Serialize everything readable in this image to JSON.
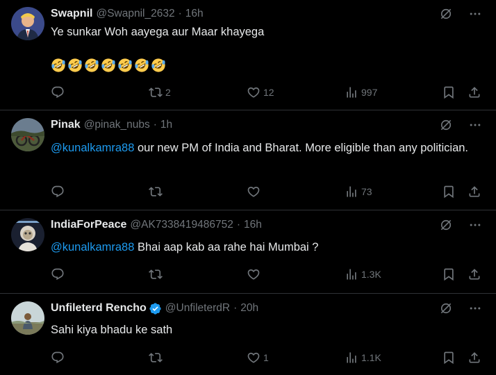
{
  "tweets": [
    {
      "name": "Swapnil",
      "handle": "@Swapnil_2632",
      "sep": "·",
      "time": "16h",
      "text": "Ye sunkar Woh aayega aur Maar khayega",
      "emoji": [
        "🤣",
        "🤣",
        "🤣",
        "🤣",
        "🤣",
        "🤣",
        "🤣"
      ],
      "replies": "",
      "reposts": "2",
      "likes": "12",
      "views": "997"
    },
    {
      "name": "Pinak",
      "handle": "@pinak_nubs",
      "sep": "·",
      "time": "1h",
      "mention": "@kunalkamra88",
      "text": " our new PM of India and Bharat. More eligible than any politician.",
      "replies": "",
      "reposts": "",
      "likes": "",
      "views": "73"
    },
    {
      "name": "IndiaForPeace",
      "handle": "@AK7338419486752",
      "sep": "·",
      "time": "16h",
      "mention": "@kunalkamra88",
      "text": " Bhai aap kab aa rahe hai Mumbai ?",
      "replies": "",
      "reposts": "",
      "likes": "",
      "views": "1.3K"
    },
    {
      "name": "Unfileterd Rencho",
      "handle": "@UnfileterdR",
      "sep": "·",
      "time": "20h",
      "text": "Sahi kiya bhadu ke sath",
      "replies": "",
      "reposts": "",
      "likes": "1",
      "views": "1.1K"
    }
  ],
  "icons": {
    "reply": "reply-icon",
    "repost": "repost-icon",
    "like": "like-icon",
    "views": "views-icon",
    "bookmark": "bookmark-icon",
    "share": "share-icon",
    "grok": "grok-icon",
    "more": "more-icon",
    "verified": "verified-badge-icon"
  },
  "colors": {
    "background": "#000000",
    "text": "#e7e9ea",
    "muted": "#71767b",
    "link": "#1d9bf0",
    "divider": "#2f3336"
  }
}
